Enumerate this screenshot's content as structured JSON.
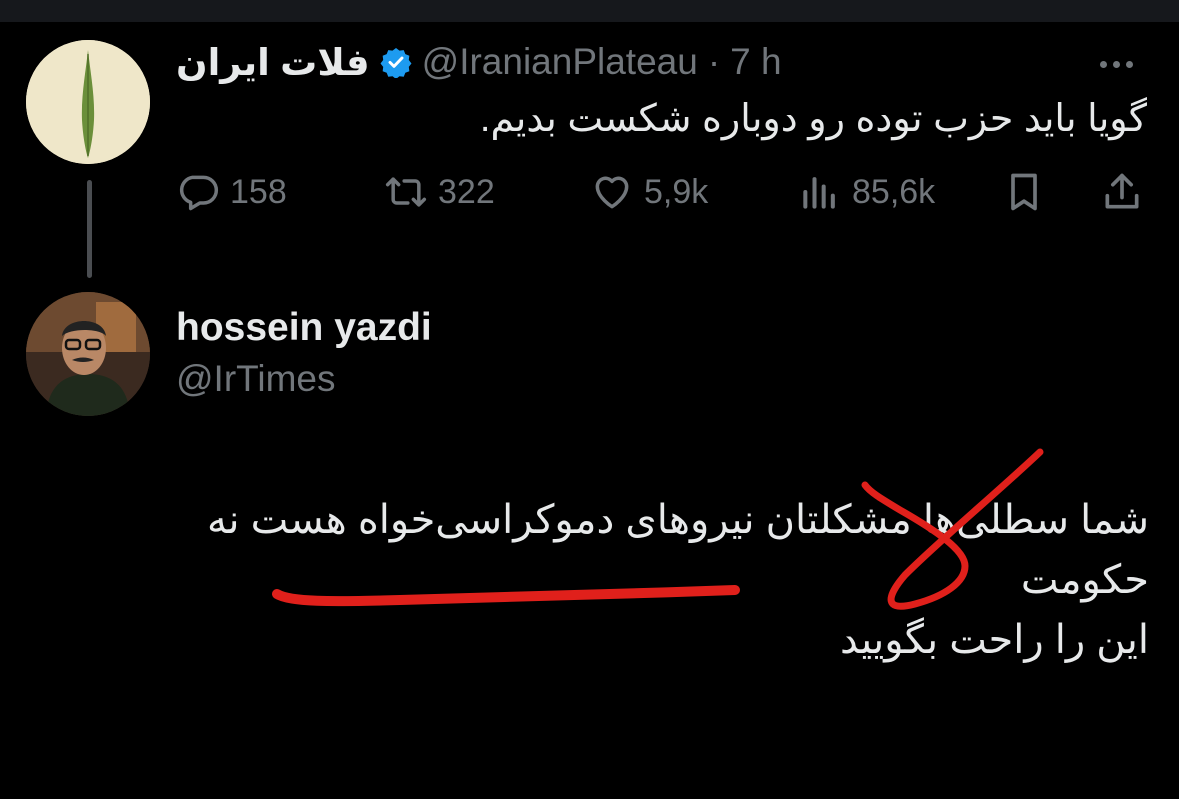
{
  "tweet": {
    "author_name": "فلات ایران",
    "handle": "@IranianPlateau",
    "separator": "·",
    "time": "7 h",
    "text": "گویا باید حزب توده رو دوباره شکست بدیم.",
    "stats": {
      "replies": "158",
      "retweets": "322",
      "likes": "5,9k",
      "views": "85,6k"
    }
  },
  "reply": {
    "author_name": "hossein yazdi",
    "handle": "@IrTimes",
    "lines": [
      "شما سطلی‌ها مشکلتان نیروهای دموکراسی‌خواه هست نه",
      "حکومت",
      "این را راحت بگویید"
    ]
  },
  "colors": {
    "background": "#000000",
    "text": "#e7e9ea",
    "muted": "#71767b",
    "verified": "#1d9bf0",
    "annotation": "#e0201b"
  },
  "icons": [
    "verified-badge-icon",
    "more-icon",
    "reply-icon",
    "retweet-icon",
    "like-icon",
    "views-icon",
    "bookmark-icon",
    "share-icon"
  ]
}
